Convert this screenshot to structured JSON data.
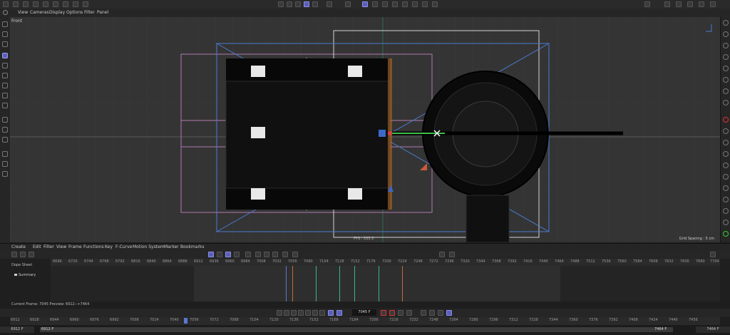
{
  "menu": [
    "View",
    "Cameras",
    "Display",
    "Options",
    "Filter",
    "Panel"
  ],
  "viewport": {
    "label": "Front",
    "fps": "FPS : 333.3",
    "grid_spacing": "Grid Spacing : 5 cm"
  },
  "timeline": {
    "menu": [
      "Create",
      "Edit",
      "Filter",
      "View",
      "Frame",
      "Functions",
      "Key",
      "F-Curve",
      "Motion System",
      "Marker",
      "Bookmarks"
    ],
    "dope_sheet": "Dope Sheet",
    "summary": "Summary",
    "ruler": [
      "6696",
      "6720",
      "6744",
      "6768",
      "6792",
      "6816",
      "6840",
      "6864",
      "6888",
      "6912",
      "6936",
      "6960",
      "6984",
      "7008",
      "7032",
      "7056",
      "7080",
      "7104",
      "7128",
      "7152",
      "7176",
      "7200",
      "7224",
      "7248",
      "7272",
      "7296",
      "7320",
      "7344",
      "7368",
      "7392",
      "7416",
      "7440",
      "7464",
      "7488",
      "7512",
      "7536",
      "7560",
      "7584",
      "7608",
      "7632",
      "7656",
      "7680",
      "7704"
    ],
    "current_frame": "Current Frame: 7045  Preview: 6912-->7464",
    "frame_field": "7045 F",
    "ruler2": [
      "6912",
      "6928",
      "6944",
      "6960",
      "6976",
      "6992",
      "7008",
      "7024",
      "7040",
      "7056",
      "7072",
      "7088",
      "7104",
      "7120",
      "7136",
      "7152",
      "7168",
      "7184",
      "7200",
      "7216",
      "7232",
      "7248",
      "7264",
      "7280",
      "7296",
      "7312",
      "7328",
      "7344",
      "7360",
      "7376",
      "7392",
      "7408",
      "7424",
      "7440",
      "7456"
    ],
    "range_start": "6912 F",
    "range_start2": "6912 F",
    "range_end": "7464 F",
    "range_end2": "7464 F"
  }
}
